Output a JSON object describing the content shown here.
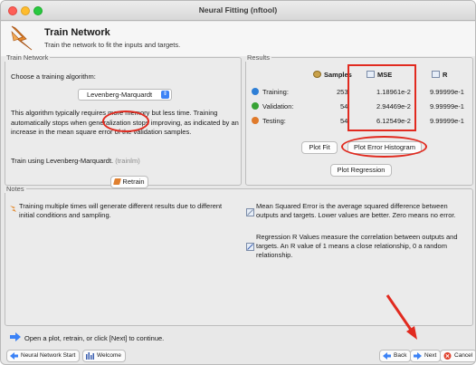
{
  "window": {
    "title": "Neural Fitting (nftool)"
  },
  "header": {
    "title": "Train Network",
    "subtitle": "Train the network to fit the inputs and targets."
  },
  "train_panel": {
    "legend": "Train Network",
    "choose_label": "Choose a training algorithm:",
    "algorithm": "Levenberg-Marquardt",
    "description": "This algorithm typically requires more memory but less time. Training automatically stops when generalization stops improving, as indicated by an increase in the mean square error of the validation samples.",
    "train_using": "Train using Levenberg-Marquardt.",
    "train_fn": "(trainlm)",
    "retrain_label": "Retrain"
  },
  "results": {
    "legend": "Results",
    "headers": {
      "samples": "Samples",
      "mse": "MSE",
      "r": "R"
    },
    "rows": [
      {
        "label": "Training:",
        "samples": "253",
        "mse": "1.18961e-2",
        "r": "9.99999e-1",
        "color": "#2f7fd6"
      },
      {
        "label": "Validation:",
        "samples": "54",
        "mse": "2.94469e-2",
        "r": "9.99999e-1",
        "color": "#37a335"
      },
      {
        "label": "Testing:",
        "samples": "54",
        "mse": "6.12549e-2",
        "r": "9.99999e-1",
        "color": "#e07a2a"
      }
    ],
    "plot_fit_label": "Plot Fit",
    "plot_hist_label": "Plot Error Histogram",
    "plot_reg_label": "Plot Regression"
  },
  "notes": {
    "legend": "Notes",
    "left": "Training multiple times will generate different results due to different initial conditions and sampling.",
    "mse_note": "Mean Squared Error is the average squared difference between outputs and targets. Lower values are better. Zero means no error.",
    "r_note": "Regression R Values measure the correlation between outputs and targets. An R value of 1 means a close relationship, 0 a random relationship."
  },
  "footer": {
    "continue_text": "Open a plot, retrain, or click [Next] to continue.",
    "nn_start": "Neural Network Start",
    "welcome": "Welcome",
    "back": "Back",
    "next": "Next",
    "cancel": "Cancel"
  },
  "colors": {
    "annotation_red": "#e12a1f"
  }
}
